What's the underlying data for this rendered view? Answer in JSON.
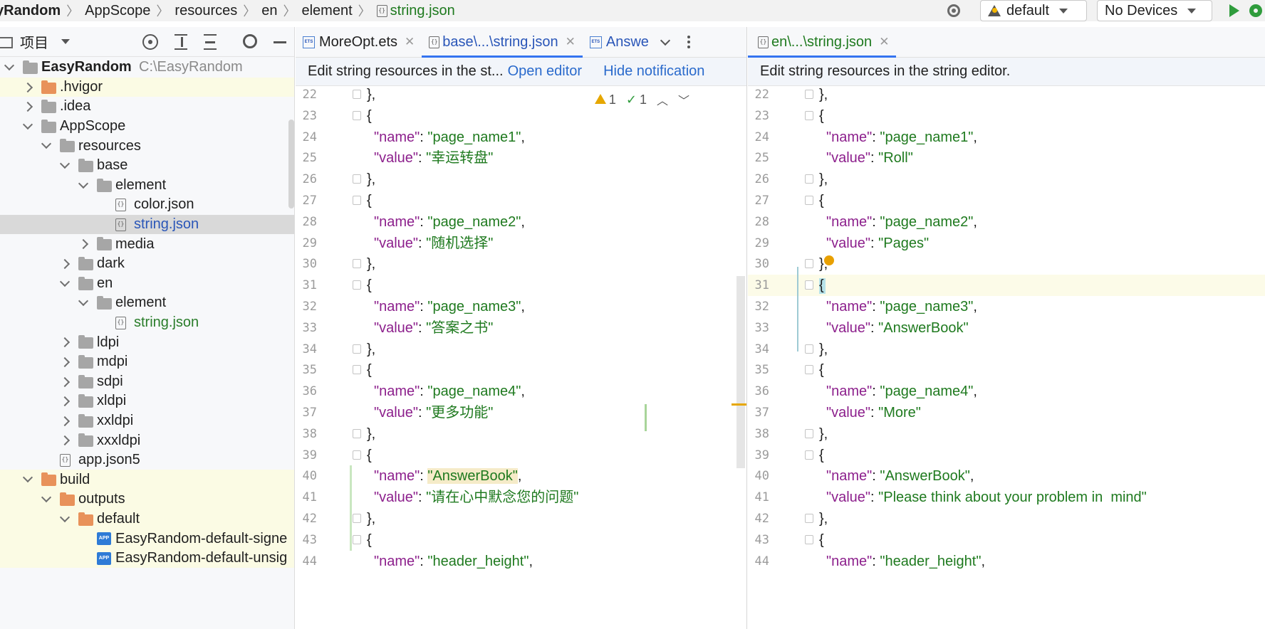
{
  "breadcrumb": {
    "items": [
      "yRandom",
      "AppScope",
      "resources",
      "en",
      "element",
      "string.json"
    ]
  },
  "toolbar": {
    "config_label": "default",
    "device_label": "No Devices"
  },
  "project_panel": {
    "title": "项目",
    "tree": [
      {
        "label": "EasyRandom",
        "path": "C:\\EasyRandom",
        "indent": 0,
        "type": "root",
        "expanded": true
      },
      {
        "label": ".hvigor",
        "indent": 1,
        "type": "folder-orange",
        "expanded": false,
        "highlight": true
      },
      {
        "label": ".idea",
        "indent": 1,
        "type": "folder",
        "expanded": false
      },
      {
        "label": "AppScope",
        "indent": 1,
        "type": "folder",
        "expanded": true
      },
      {
        "label": "resources",
        "indent": 2,
        "type": "folder",
        "expanded": true
      },
      {
        "label": "base",
        "indent": 3,
        "type": "folder",
        "expanded": true
      },
      {
        "label": "element",
        "indent": 4,
        "type": "folder",
        "expanded": true
      },
      {
        "label": "color.json",
        "indent": 5,
        "type": "json"
      },
      {
        "label": "string.json",
        "indent": 5,
        "type": "json",
        "selected": true,
        "color": "blue"
      },
      {
        "label": "media",
        "indent": 4,
        "type": "folder",
        "expanded": false
      },
      {
        "label": "dark",
        "indent": 3,
        "type": "folder",
        "expanded": false
      },
      {
        "label": "en",
        "indent": 3,
        "type": "folder",
        "expanded": true
      },
      {
        "label": "element",
        "indent": 4,
        "type": "folder",
        "expanded": true
      },
      {
        "label": "string.json",
        "indent": 5,
        "type": "json",
        "color": "green"
      },
      {
        "label": "ldpi",
        "indent": 3,
        "type": "folder",
        "expanded": false
      },
      {
        "label": "mdpi",
        "indent": 3,
        "type": "folder",
        "expanded": false
      },
      {
        "label": "sdpi",
        "indent": 3,
        "type": "folder",
        "expanded": false
      },
      {
        "label": "xldpi",
        "indent": 3,
        "type": "folder",
        "expanded": false
      },
      {
        "label": "xxldpi",
        "indent": 3,
        "type": "folder",
        "expanded": false
      },
      {
        "label": "xxxldpi",
        "indent": 3,
        "type": "folder",
        "expanded": false
      },
      {
        "label": "app.json5",
        "indent": 2,
        "type": "json"
      },
      {
        "label": "build",
        "indent": 1,
        "type": "folder-orange",
        "expanded": true,
        "highlight": true
      },
      {
        "label": "outputs",
        "indent": 2,
        "type": "folder-orange",
        "expanded": true,
        "highlight": true
      },
      {
        "label": "default",
        "indent": 3,
        "type": "folder-orange",
        "expanded": true,
        "highlight": true
      },
      {
        "label": "EasyRandom-default-signe",
        "indent": 4,
        "type": "app",
        "highlight": true
      },
      {
        "label": "EasyRandom-default-unsig",
        "indent": 4,
        "type": "app",
        "highlight": true
      }
    ]
  },
  "left_editor": {
    "tabs": [
      {
        "label": "MoreOpt.ets",
        "icon": "ets",
        "closable": true,
        "active": false
      },
      {
        "label": "base\\...\\string.json",
        "icon": "json",
        "closable": true,
        "active": true
      },
      {
        "label": "Answe",
        "icon": "ets",
        "closable": false,
        "active": false
      }
    ],
    "notification": {
      "text": "Edit string resources in the st...",
      "open_link": "Open editor",
      "hide_link": "Hide notification"
    },
    "inspection": {
      "warnings": "1",
      "checks": "1"
    },
    "lines": [
      {
        "n": "22",
        "t": "close"
      },
      {
        "n": "23",
        "t": "open"
      },
      {
        "n": "24",
        "t": "name",
        "v": "page_name1"
      },
      {
        "n": "25",
        "t": "value",
        "v": "幸运转盘"
      },
      {
        "n": "26",
        "t": "close"
      },
      {
        "n": "27",
        "t": "open"
      },
      {
        "n": "28",
        "t": "name",
        "v": "page_name2"
      },
      {
        "n": "29",
        "t": "value",
        "v": "随机选择"
      },
      {
        "n": "30",
        "t": "close"
      },
      {
        "n": "31",
        "t": "open"
      },
      {
        "n": "32",
        "t": "name",
        "v": "page_name3"
      },
      {
        "n": "33",
        "t": "value",
        "v": "答案之书"
      },
      {
        "n": "34",
        "t": "close"
      },
      {
        "n": "35",
        "t": "open"
      },
      {
        "n": "36",
        "t": "name",
        "v": "page_name4"
      },
      {
        "n": "37",
        "t": "value",
        "v": "更多功能"
      },
      {
        "n": "38",
        "t": "close"
      },
      {
        "n": "39",
        "t": "open"
      },
      {
        "n": "40",
        "t": "name",
        "v": "AnswerBook",
        "hl": true
      },
      {
        "n": "41",
        "t": "value",
        "v": "请在心中默念您的问题"
      },
      {
        "n": "42",
        "t": "close"
      },
      {
        "n": "43",
        "t": "open"
      },
      {
        "n": "44",
        "t": "name",
        "v": "header_height"
      }
    ]
  },
  "right_editor": {
    "tabs": [
      {
        "label": "en\\...\\string.json",
        "icon": "json",
        "closable": true,
        "active": true
      }
    ],
    "notification": {
      "text": "Edit string resources in the string editor."
    },
    "lines": [
      {
        "n": "22",
        "t": "close"
      },
      {
        "n": "23",
        "t": "open"
      },
      {
        "n": "24",
        "t": "name",
        "v": "page_name1"
      },
      {
        "n": "25",
        "t": "value",
        "v": "Roll"
      },
      {
        "n": "26",
        "t": "close"
      },
      {
        "n": "27",
        "t": "open"
      },
      {
        "n": "28",
        "t": "name",
        "v": "page_name2"
      },
      {
        "n": "29",
        "t": "value",
        "v": "Pages"
      },
      {
        "n": "30",
        "t": "close",
        "bulb": true
      },
      {
        "n": "31",
        "t": "open",
        "current": true
      },
      {
        "n": "32",
        "t": "name",
        "v": "page_name3"
      },
      {
        "n": "33",
        "t": "value",
        "v": "AnswerBook"
      },
      {
        "n": "34",
        "t": "close"
      },
      {
        "n": "35",
        "t": "open"
      },
      {
        "n": "36",
        "t": "name",
        "v": "page_name4"
      },
      {
        "n": "37",
        "t": "value",
        "v": "More"
      },
      {
        "n": "38",
        "t": "close"
      },
      {
        "n": "39",
        "t": "open"
      },
      {
        "n": "40",
        "t": "name",
        "v": "AnswerBook"
      },
      {
        "n": "41",
        "t": "value",
        "v": "Please think about your problem in  mind"
      },
      {
        "n": "42",
        "t": "close"
      },
      {
        "n": "43",
        "t": "open"
      },
      {
        "n": "44",
        "t": "name",
        "v": "header_height"
      }
    ]
  },
  "syntax": {
    "key_name": "\"name\"",
    "key_value": "\"value\"",
    "open_brace": "{",
    "close_brace": "},"
  },
  "colors": {
    "key": "#8c1f8c",
    "string": "#1f7a1f",
    "accent": "#3574f0",
    "link": "#2a6acc"
  }
}
